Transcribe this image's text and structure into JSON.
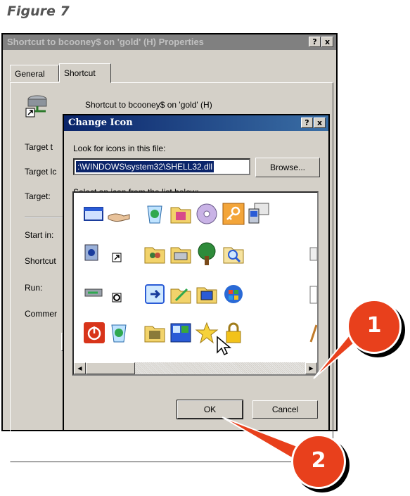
{
  "figure_caption": "Figure 7",
  "properties_window": {
    "title": "Shortcut to bcooney$ on 'gold' (H) Properties",
    "help_button": "?",
    "close_button": "x",
    "tabs": [
      "General",
      "Shortcut"
    ],
    "active_tab": "Shortcut",
    "shortcut_name": "Shortcut to bcooney$ on 'gold' (H)",
    "field_labels": [
      "Target t",
      "Target lc",
      "Target:",
      "Start in:",
      "Shortcut",
      "Run:",
      "Commer"
    ]
  },
  "change_icon_dialog": {
    "title": "Change Icon",
    "help_button": "?",
    "close_button": "x",
    "look_for_label": "Look for icons in this file:",
    "file_path_value": ":\\WINDOWS\\system32\\SHELL32.dll",
    "browse_button": "Browse...",
    "select_icon_label": "Select an icon from the list below:",
    "ok_button": "OK",
    "cancel_button": "Cancel"
  },
  "callouts": [
    "1",
    "2"
  ],
  "colors": {
    "title_active": "#0a246a",
    "title_inactive": "#808080",
    "dialog_face": "#d4d0c8",
    "callout": "#e8401c"
  }
}
